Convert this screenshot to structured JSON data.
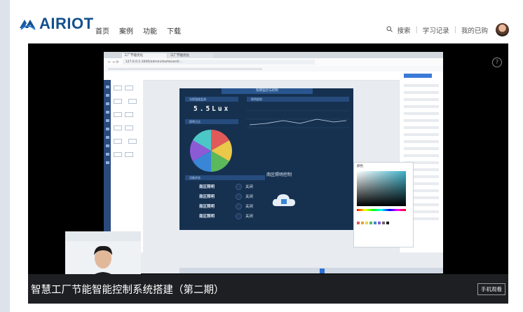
{
  "header": {
    "logo": "AIRIOT",
    "nav": [
      "首页",
      "案例",
      "功能",
      "下载"
    ],
    "search_label": "搜索",
    "study_record": "学习记录",
    "my_purchased": "我的已购"
  },
  "video": {
    "title": "智慧工厂节能智能控制系统搭建（第二期）",
    "mobile_watch": "手机观看",
    "help": "?"
  },
  "screen": {
    "browser": {
      "tabs": [
        "工厂节能优化",
        "工厂节能优化"
      ],
      "url": "127.0.0.1:3000/admin/dashboard/..."
    },
    "dashboard": {
      "title": "照明监控与控制",
      "panel_lux": "光照强度监测",
      "panel_trend": "照明趋势",
      "panel_ratio": "照明占比",
      "panel_state": "设备状态",
      "lux_value": "5.5Lux",
      "zones": [
        {
          "name": "南区照明",
          "state": "关闭"
        },
        {
          "name": "南区照明",
          "state": "关闭"
        },
        {
          "name": "南区照明",
          "state": "关闭"
        },
        {
          "name": "南区照明",
          "state": "关闭"
        }
      ],
      "control_title": "南区照明控制",
      "pie_colors": [
        "#e05a5a",
        "#e9c84a",
        "#5bb85b",
        "#3a86d6",
        "#8d5ad6",
        "#4cc7c7"
      ]
    },
    "color_picker": {
      "title": "颜色",
      "swatches": [
        "#e05a5a",
        "#e8a03c",
        "#e9d74a",
        "#5bb85b",
        "#3a86d6",
        "#8d5ad6",
        "#666666",
        "#222222"
      ]
    }
  }
}
